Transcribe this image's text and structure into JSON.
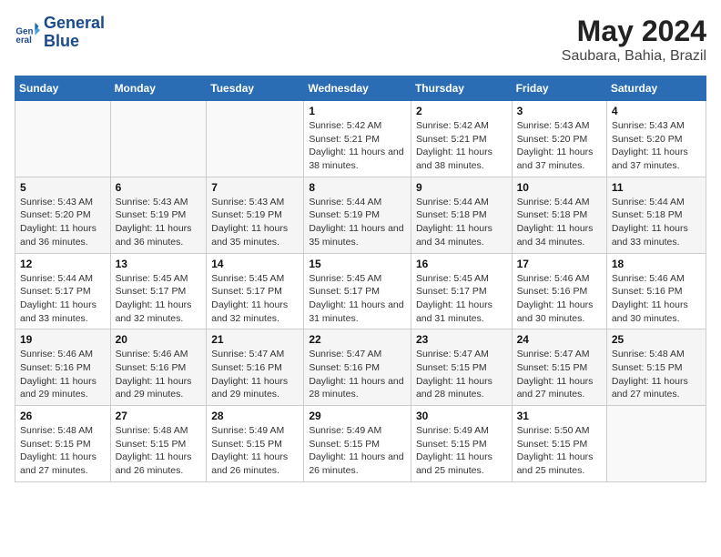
{
  "logo": {
    "line1": "General",
    "line2": "Blue"
  },
  "title": "May 2024",
  "subtitle": "Saubara, Bahia, Brazil",
  "weekdays": [
    "Sunday",
    "Monday",
    "Tuesday",
    "Wednesday",
    "Thursday",
    "Friday",
    "Saturday"
  ],
  "weeks": [
    [
      {
        "day": "",
        "info": ""
      },
      {
        "day": "",
        "info": ""
      },
      {
        "day": "",
        "info": ""
      },
      {
        "day": "1",
        "sunrise": "5:42 AM",
        "sunset": "5:21 PM",
        "daylight": "11 hours and 38 minutes."
      },
      {
        "day": "2",
        "sunrise": "5:42 AM",
        "sunset": "5:21 PM",
        "daylight": "11 hours and 38 minutes."
      },
      {
        "day": "3",
        "sunrise": "5:43 AM",
        "sunset": "5:20 PM",
        "daylight": "11 hours and 37 minutes."
      },
      {
        "day": "4",
        "sunrise": "5:43 AM",
        "sunset": "5:20 PM",
        "daylight": "11 hours and 37 minutes."
      }
    ],
    [
      {
        "day": "5",
        "sunrise": "5:43 AM",
        "sunset": "5:20 PM",
        "daylight": "11 hours and 36 minutes."
      },
      {
        "day": "6",
        "sunrise": "5:43 AM",
        "sunset": "5:19 PM",
        "daylight": "11 hours and 36 minutes."
      },
      {
        "day": "7",
        "sunrise": "5:43 AM",
        "sunset": "5:19 PM",
        "daylight": "11 hours and 35 minutes."
      },
      {
        "day": "8",
        "sunrise": "5:44 AM",
        "sunset": "5:19 PM",
        "daylight": "11 hours and 35 minutes."
      },
      {
        "day": "9",
        "sunrise": "5:44 AM",
        "sunset": "5:18 PM",
        "daylight": "11 hours and 34 minutes."
      },
      {
        "day": "10",
        "sunrise": "5:44 AM",
        "sunset": "5:18 PM",
        "daylight": "11 hours and 34 minutes."
      },
      {
        "day": "11",
        "sunrise": "5:44 AM",
        "sunset": "5:18 PM",
        "daylight": "11 hours and 33 minutes."
      }
    ],
    [
      {
        "day": "12",
        "sunrise": "5:44 AM",
        "sunset": "5:17 PM",
        "daylight": "11 hours and 33 minutes."
      },
      {
        "day": "13",
        "sunrise": "5:45 AM",
        "sunset": "5:17 PM",
        "daylight": "11 hours and 32 minutes."
      },
      {
        "day": "14",
        "sunrise": "5:45 AM",
        "sunset": "5:17 PM",
        "daylight": "11 hours and 32 minutes."
      },
      {
        "day": "15",
        "sunrise": "5:45 AM",
        "sunset": "5:17 PM",
        "daylight": "11 hours and 31 minutes."
      },
      {
        "day": "16",
        "sunrise": "5:45 AM",
        "sunset": "5:17 PM",
        "daylight": "11 hours and 31 minutes."
      },
      {
        "day": "17",
        "sunrise": "5:46 AM",
        "sunset": "5:16 PM",
        "daylight": "11 hours and 30 minutes."
      },
      {
        "day": "18",
        "sunrise": "5:46 AM",
        "sunset": "5:16 PM",
        "daylight": "11 hours and 30 minutes."
      }
    ],
    [
      {
        "day": "19",
        "sunrise": "5:46 AM",
        "sunset": "5:16 PM",
        "daylight": "11 hours and 29 minutes."
      },
      {
        "day": "20",
        "sunrise": "5:46 AM",
        "sunset": "5:16 PM",
        "daylight": "11 hours and 29 minutes."
      },
      {
        "day": "21",
        "sunrise": "5:47 AM",
        "sunset": "5:16 PM",
        "daylight": "11 hours and 29 minutes."
      },
      {
        "day": "22",
        "sunrise": "5:47 AM",
        "sunset": "5:16 PM",
        "daylight": "11 hours and 28 minutes."
      },
      {
        "day": "23",
        "sunrise": "5:47 AM",
        "sunset": "5:15 PM",
        "daylight": "11 hours and 28 minutes."
      },
      {
        "day": "24",
        "sunrise": "5:47 AM",
        "sunset": "5:15 PM",
        "daylight": "11 hours and 27 minutes."
      },
      {
        "day": "25",
        "sunrise": "5:48 AM",
        "sunset": "5:15 PM",
        "daylight": "11 hours and 27 minutes."
      }
    ],
    [
      {
        "day": "26",
        "sunrise": "5:48 AM",
        "sunset": "5:15 PM",
        "daylight": "11 hours and 27 minutes."
      },
      {
        "day": "27",
        "sunrise": "5:48 AM",
        "sunset": "5:15 PM",
        "daylight": "11 hours and 26 minutes."
      },
      {
        "day": "28",
        "sunrise": "5:49 AM",
        "sunset": "5:15 PM",
        "daylight": "11 hours and 26 minutes."
      },
      {
        "day": "29",
        "sunrise": "5:49 AM",
        "sunset": "5:15 PM",
        "daylight": "11 hours and 26 minutes."
      },
      {
        "day": "30",
        "sunrise": "5:49 AM",
        "sunset": "5:15 PM",
        "daylight": "11 hours and 25 minutes."
      },
      {
        "day": "31",
        "sunrise": "5:50 AM",
        "sunset": "5:15 PM",
        "daylight": "11 hours and 25 minutes."
      },
      {
        "day": "",
        "info": ""
      }
    ]
  ]
}
